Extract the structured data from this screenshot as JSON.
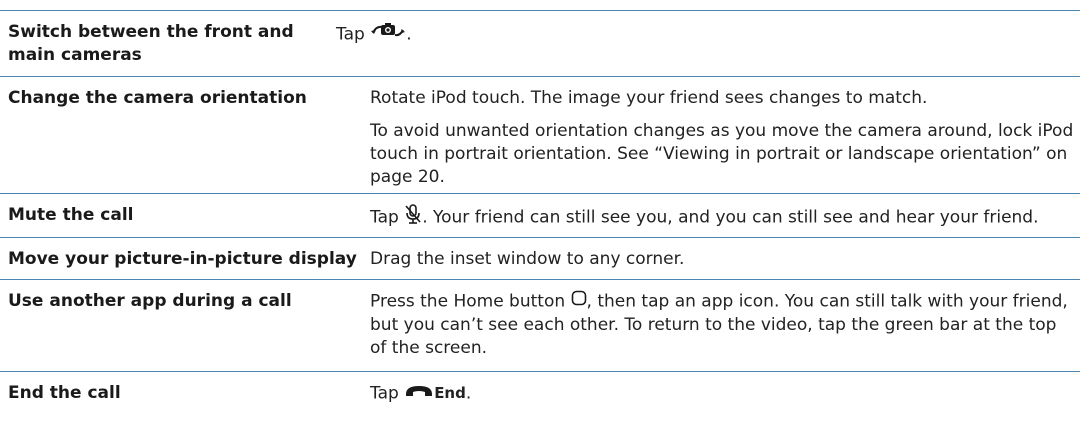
{
  "rows": [
    {
      "action": "Switch between the front and main cameras",
      "desc": [
        "Tap",
        "."
      ]
    },
    {
      "action": "Change the camera orientation",
      "desc1": "Rotate iPod touch. The image your friend sees changes to match.",
      "desc2": "To avoid unwanted orientation changes as you move the camera around, lock iPod touch in portrait orientation. See “Viewing in portrait or landscape orientation” on page 20."
    },
    {
      "action": "Mute the call",
      "desc": [
        "Tap",
        ". Your friend can still see you, and you can still see and hear your friend."
      ]
    },
    {
      "action": "Move your picture-in-picture display",
      "desc1": "Drag the inset window to any corner."
    },
    {
      "action": "Use another app during a call",
      "desc": [
        "Press the Home button",
        ", then tap an app icon. You can still talk with your friend, but you can’t see each other. To return to the video, tap the green bar at the top of the screen."
      ]
    },
    {
      "action": "End the call",
      "desc": [
        "Tap",
        "End",
        "."
      ]
    }
  ],
  "icons": [
    "switch-camera-icon",
    "mute-icon",
    "home-button-icon",
    "end-call-icon"
  ]
}
